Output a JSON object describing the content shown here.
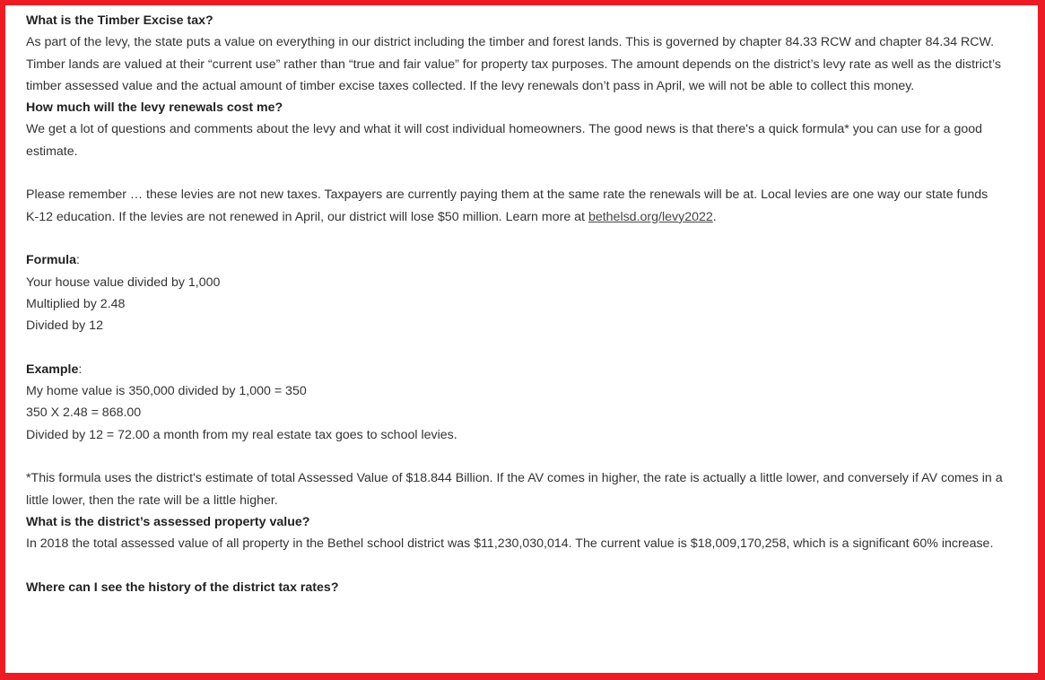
{
  "faq": {
    "timber_question": "What is the Timber Excise tax?",
    "timber_answer": "As part of the levy, the state puts a value on everything in our district including the timber and forest lands. This is governed by chapter 84.33 RCW and chapter 84.34 RCW. Timber lands are valued at their “current use” rather than “true and fair value” for property tax purposes. The amount depends on the district’s levy rate as well as the district’s timber assessed value and the actual amount of timber excise taxes collected. If the levy renewals don’t pass in April, we will not be able to collect this money.",
    "cost_question": "How much will the levy renewals cost me?",
    "cost_answer": "We get a lot of questions and comments about the levy and what it will cost individual homeowners. The good news is that there's a quick formula* you can use for a good estimate.",
    "remember_text": "Please remember … these levies are not new taxes. Taxpayers are currently paying them at the same rate the renewals will be at. Local levies are one way our state funds K-12 education. If the levies are not renewed in April, our district will lose $50 million. Learn more at ",
    "remember_link": "bethelsd.org/levy2022",
    "remember_end": ".",
    "formula_label": "Formula",
    "formula_steps": [
      "Your house value divided by 1,000",
      "Multiplied by 2.48",
      "Divided by 12"
    ],
    "example_label": "Example",
    "example_steps": [
      "My home value is 350,000 divided by 1,000 = 350",
      "350 X 2.48 = 868.00",
      "Divided by 12 = 72.00 a month from my real estate tax goes to school levies."
    ],
    "footnote": "*This formula uses the district's estimate of total Assessed Value of $18.844 Billion. If the AV comes in higher, the rate is actually a little lower, and conversely if AV comes in a little lower, then the rate will be a little higher.",
    "assessed_question": "What is the district’s assessed property value?",
    "assessed_answer": "In 2018 the total assessed value of all property in the Bethel school district was $11,230,030,014. The current value is $18,009,170,258, which is a significant 60% increase.",
    "history_question": "Where can I see the history of the district tax rates?"
  },
  "colors": {
    "frame": "#ed1c24",
    "text": "#333333"
  }
}
